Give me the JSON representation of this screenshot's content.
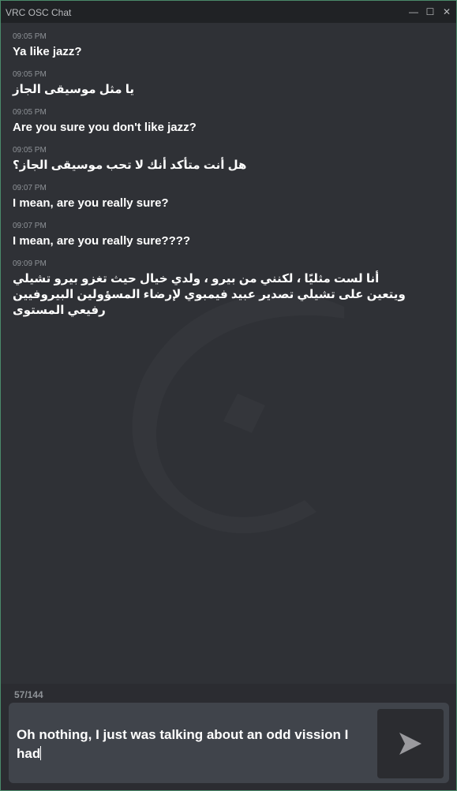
{
  "window": {
    "title": "VRC OSC Chat",
    "minimize_glyph": "—",
    "maximize_glyph": "☐",
    "close_glyph": "✕"
  },
  "messages": [
    {
      "time": "09:05 PM",
      "text": "Ya like jazz?",
      "rtl": false
    },
    {
      "time": "09:05 PM",
      "text": "يا مثل موسيقى الجاز",
      "rtl": true
    },
    {
      "time": "09:05 PM",
      "text": "Are you sure you don't like jazz?",
      "rtl": false
    },
    {
      "time": "09:05 PM",
      "text": "هل أنت متأكد أنك لا تحب موسيقى الجاز؟",
      "rtl": true
    },
    {
      "time": "09:07 PM",
      "text": "I mean, are you really sure?",
      "rtl": false
    },
    {
      "time": "09:07 PM",
      "text": "I mean, are you really sure????",
      "rtl": false
    },
    {
      "time": "09:09 PM",
      "text": "أنا لست مثليًا ، لكنني من بيرو ، ولدي خيال حيث تغزو بيرو تشيلي ويتعين على تشيلي تصدير عبيد فيمبوي لإرضاء المسؤولين البيروفيين رفيعي المستوى",
      "rtl": true
    }
  ],
  "input": {
    "char_count": "57/144",
    "value": "Oh nothing, I just was talking about an odd vission I had"
  },
  "icons": {
    "send": "send-arrow-icon",
    "watermark": "logo-watermark"
  },
  "colors": {
    "background": "#2f3136",
    "titlebar": "#202225",
    "input_bg": "#40444b",
    "send_bg": "#2b2c30",
    "text": "#ffffff",
    "muted": "#8e9297"
  }
}
